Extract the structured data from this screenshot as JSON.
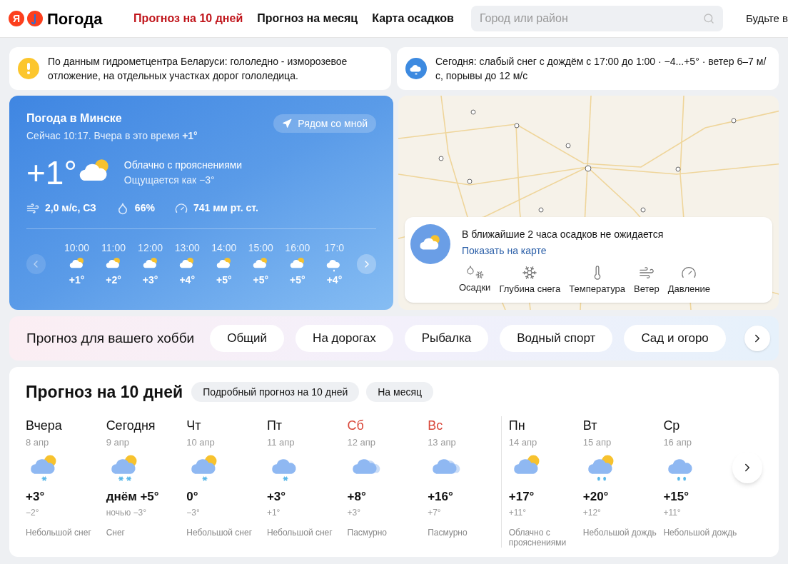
{
  "header": {
    "logo_letter": "Я",
    "brand": "Погода",
    "nav": [
      {
        "label": "Прогноз на 10 дней",
        "selected": true
      },
      {
        "label": "Прогноз на месяц",
        "selected": false
      },
      {
        "label": "Карта осадков",
        "selected": false
      }
    ],
    "search": {
      "placeholder": "Город или район"
    },
    "cut_link": "Будьте в"
  },
  "alerts": [
    {
      "kind": "warning",
      "text": "По данным гидрометцентра Беларуси: гололедно - изморозевое отложение, на отдельных участках дорог гололедица."
    },
    {
      "kind": "precip",
      "text": "Сегодня: слабый снег с дождём с 17:00 до 1:00 · −4...+5° · ветер 6–7 м/с, порывы до 12 м/с"
    }
  ],
  "current": {
    "title": "Погода в Минске",
    "subtitle": "Сейчас 10:17. Вчера в это время **+1°**",
    "nearby_button": "Рядом со мной",
    "temp": "+1°",
    "kind": "partly_cloudy",
    "condition": "Облачно с прояснениями",
    "feels_like": "Ощущается как −3°",
    "wind": "2,0 м/с, СЗ",
    "humidity": "66%",
    "pressure": "741 мм рт. ст.",
    "hourly": [
      {
        "time": "10:00",
        "kind": "partly_cloudy",
        "temp": "+1°"
      },
      {
        "time": "11:00",
        "kind": "partly_cloudy",
        "temp": "+2°"
      },
      {
        "time": "12:00",
        "kind": "partly_cloudy",
        "temp": "+3°"
      },
      {
        "time": "13:00",
        "kind": "partly_cloudy",
        "temp": "+4°"
      },
      {
        "time": "14:00",
        "kind": "partly_cloudy",
        "temp": "+5°"
      },
      {
        "time": "15:00",
        "kind": "partly_cloudy",
        "temp": "+5°"
      },
      {
        "time": "16:00",
        "kind": "partly_cloudy",
        "temp": "+5°"
      },
      {
        "time": "17:0",
        "kind": "cloud_drop",
        "temp": "+4°"
      }
    ]
  },
  "map": {
    "precip_text": "В ближайшие 2 часа осадков не ожидается",
    "show_link": "Показать на карте",
    "layers": [
      {
        "kind": "precip",
        "label": "Осадки"
      },
      {
        "kind": "snow",
        "label": "Глубина снега"
      },
      {
        "kind": "temperature",
        "label": "Температура"
      },
      {
        "kind": "wind",
        "label": "Ветер"
      },
      {
        "kind": "pressure",
        "label": "Давление"
      }
    ]
  },
  "hobby": {
    "title": "Прогноз для вашего хобби",
    "items": [
      "Общий",
      "На дорогах",
      "Рыбалка",
      "Водный спорт",
      "Сад и огоро"
    ]
  },
  "forecast": {
    "title": "Прогноз на 10 дней",
    "buttons": [
      "Подробный прогноз на 10 дней",
      "На месяц"
    ],
    "days": [
      {
        "name": "Вчера",
        "date": "8 апр",
        "kind": "partly_cloudy_snow",
        "day_temp": "+3°",
        "night_temp": "−2°",
        "condition": "Небольшой снег",
        "weekend": false,
        "week_start": false
      },
      {
        "name": "Сегодня",
        "date": "9 апр",
        "kind": "partly_cloudy_snow2",
        "day_temp": "днём +5°",
        "night_temp": "ночью −3°",
        "condition": "Снег",
        "weekend": false,
        "week_start": false
      },
      {
        "name": "Чт",
        "date": "10 апр",
        "kind": "partly_cloudy_snow",
        "day_temp": "0°",
        "night_temp": "−3°",
        "condition": "Небольшой снег",
        "weekend": false,
        "week_start": false
      },
      {
        "name": "Пт",
        "date": "11 апр",
        "kind": "cloud_snow",
        "day_temp": "+3°",
        "night_temp": "+1°",
        "condition": "Небольшой снег",
        "weekend": false,
        "week_start": false
      },
      {
        "name": "Сб",
        "date": "12 апр",
        "kind": "overcast",
        "day_temp": "+8°",
        "night_temp": "+3°",
        "condition": "Пасмурно",
        "weekend": true,
        "week_start": false
      },
      {
        "name": "Вс",
        "date": "13 апр",
        "kind": "overcast",
        "day_temp": "+16°",
        "night_temp": "+7°",
        "condition": "Пасмурно",
        "weekend": true,
        "week_start": false
      },
      {
        "name": "Пн",
        "date": "14 апр",
        "kind": "partly_cloudy",
        "day_temp": "+17°",
        "night_temp": "+11°",
        "condition": "Облачно с прояснениями",
        "weekend": false,
        "week_start": true
      },
      {
        "name": "Вт",
        "date": "15 апр",
        "kind": "partly_cloudy_rain",
        "day_temp": "+20°",
        "night_temp": "+12°",
        "condition": "Небольшой дождь",
        "weekend": false,
        "week_start": false
      },
      {
        "name": "Ср",
        "date": "16 апр",
        "kind": "cloud_rain",
        "day_temp": "+15°",
        "night_temp": "+11°",
        "condition": "Небольшой дождь",
        "weekend": false,
        "week_start": false
      }
    ]
  }
}
